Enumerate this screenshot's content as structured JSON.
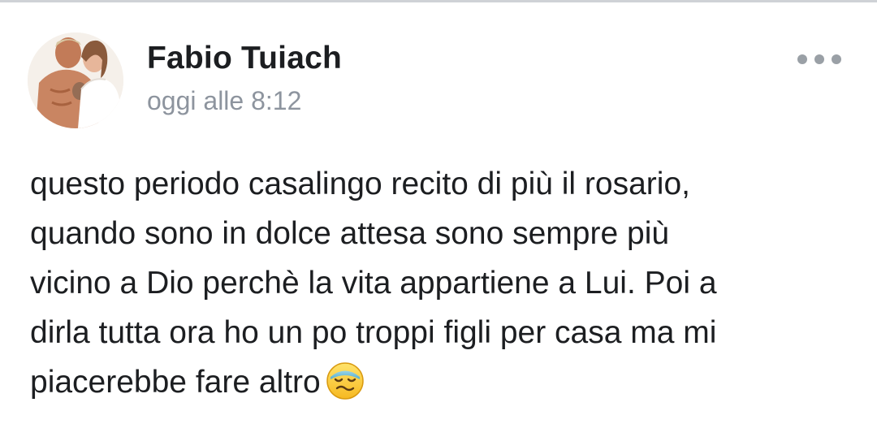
{
  "post": {
    "author": "Fabio Tuiach",
    "timestamp": "oggi alle 8:12",
    "text_lines": [
      "questo periodo casalingo recito di più il rosario,",
      "quando sono in dolce attesa sono sempre più",
      "vicino a Dio perchè la vita appartiene a Lui. Poi a",
      "dirla tutta ora ho un po troppi figli per casa ma mi",
      "piacerebbe fare altro"
    ],
    "emoji": "sweat-smile-emoji",
    "more_icon": "more-horizontal-icon",
    "avatar": "profile-photo-avatar"
  },
  "colors": {
    "text": "#1c1e21",
    "timestamp": "#8d949e",
    "icon": "#9aa0a6",
    "divider": "#cfd2d6"
  }
}
